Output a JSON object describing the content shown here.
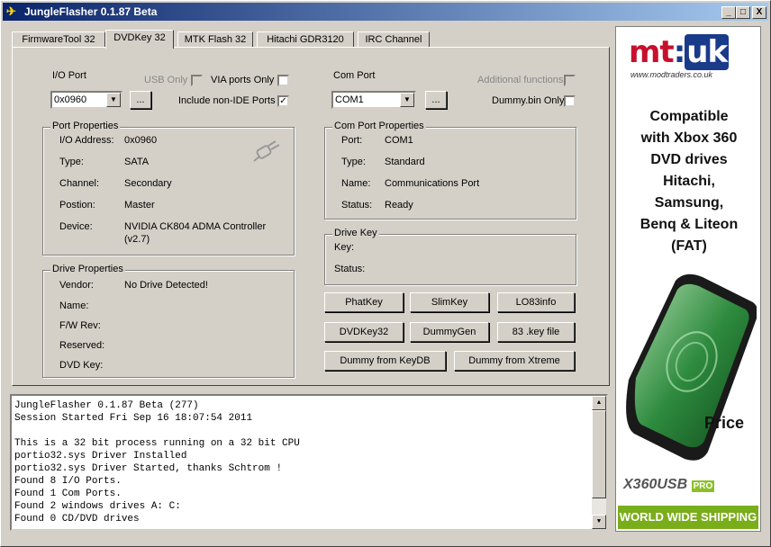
{
  "window": {
    "title": "JungleFlasher 0.1.87 Beta",
    "minimize": "_",
    "maximize": "□",
    "close": "X"
  },
  "tabs": [
    "FirmwareTool 32",
    "DVDKey 32",
    "MTK Flash 32",
    "Hitachi GDR3120",
    "IRC Channel"
  ],
  "io": {
    "label": "I/O Port",
    "usb_only": "USB Only",
    "via_ports_only": "VIA ports Only",
    "port_value": "0x0960",
    "browse": "...",
    "include_non_ide": "Include non-IDE Ports",
    "include_non_ide_checked": "✓"
  },
  "com": {
    "label": "Com Port",
    "additional_functions": "Additional functions",
    "port_value": "COM1",
    "browse": "...",
    "dummy_only": "Dummy.bin Only"
  },
  "port_properties": {
    "title": "Port Properties",
    "rows": [
      {
        "label": "I/O Address:",
        "value": "0x0960"
      },
      {
        "label": "Type:",
        "value": "SATA"
      },
      {
        "label": "Channel:",
        "value": "Secondary"
      },
      {
        "label": "Postion:",
        "value": "Master"
      },
      {
        "label": "Device:",
        "value": "NVIDIA CK804 ADMA Controller"
      }
    ],
    "device_extra": "(v2.7)"
  },
  "com_properties": {
    "title": "Com Port Properties",
    "rows": [
      {
        "label": "Port:",
        "value": "COM1"
      },
      {
        "label": "Type:",
        "value": "Standard"
      },
      {
        "label": "Name:",
        "value": "Communications Port"
      },
      {
        "label": "Status:",
        "value": "Ready"
      }
    ]
  },
  "drive_key": {
    "title": "Drive Key",
    "key_label": "Key:",
    "status_label": "Status:"
  },
  "drive_properties": {
    "title": "Drive Properties",
    "rows": [
      {
        "label": "Vendor:",
        "value": "No Drive Detected!"
      },
      {
        "label": "Name:",
        "value": ""
      },
      {
        "label": "F/W Rev:",
        "value": ""
      },
      {
        "label": "Reserved:",
        "value": ""
      },
      {
        "label": "DVD Key:",
        "value": ""
      }
    ]
  },
  "buttons": {
    "phatkey": "PhatKey",
    "slimkey": "SlimKey",
    "lo83info": "LO83info",
    "dvdkey32": "DVDKey32",
    "dummygen": "DummyGen",
    "key83": "83 .key file",
    "dummy_keydb": "Dummy from KeyDB",
    "dummy_xtreme": "Dummy from Xtreme"
  },
  "log": [
    "JungleFlasher 0.1.87 Beta (277)",
    "Session Started Fri Sep 16 18:07:54 2011",
    "",
    "This is a 32 bit process running on a 32 bit CPU",
    "portio32.sys Driver Installed",
    "portio32.sys Driver Started, thanks Schtrom !",
    "Found 8 I/O Ports.",
    "Found 1 Com Ports.",
    "Found 2 windows drives A: C:",
    "Found 0 CD/DVD drives"
  ],
  "ad": {
    "logo_mt": "mt",
    "logo_colon": ":",
    "logo_uk": "uk",
    "url": "www.modtraders.co.uk",
    "lines": [
      "Compatible",
      "with Xbox 360",
      "DVD drives",
      "Hitachi,",
      "Samsung,",
      "Benq & Liteon",
      "(FAT)"
    ],
    "price": "Price",
    "brand": "X360USB",
    "brand_pro": "PRO",
    "shipping": "WORLD WIDE SHIPPING",
    "colors": {
      "red": "#c8102e",
      "blue": "#1a3a8a",
      "green": "#7aad1a"
    }
  }
}
